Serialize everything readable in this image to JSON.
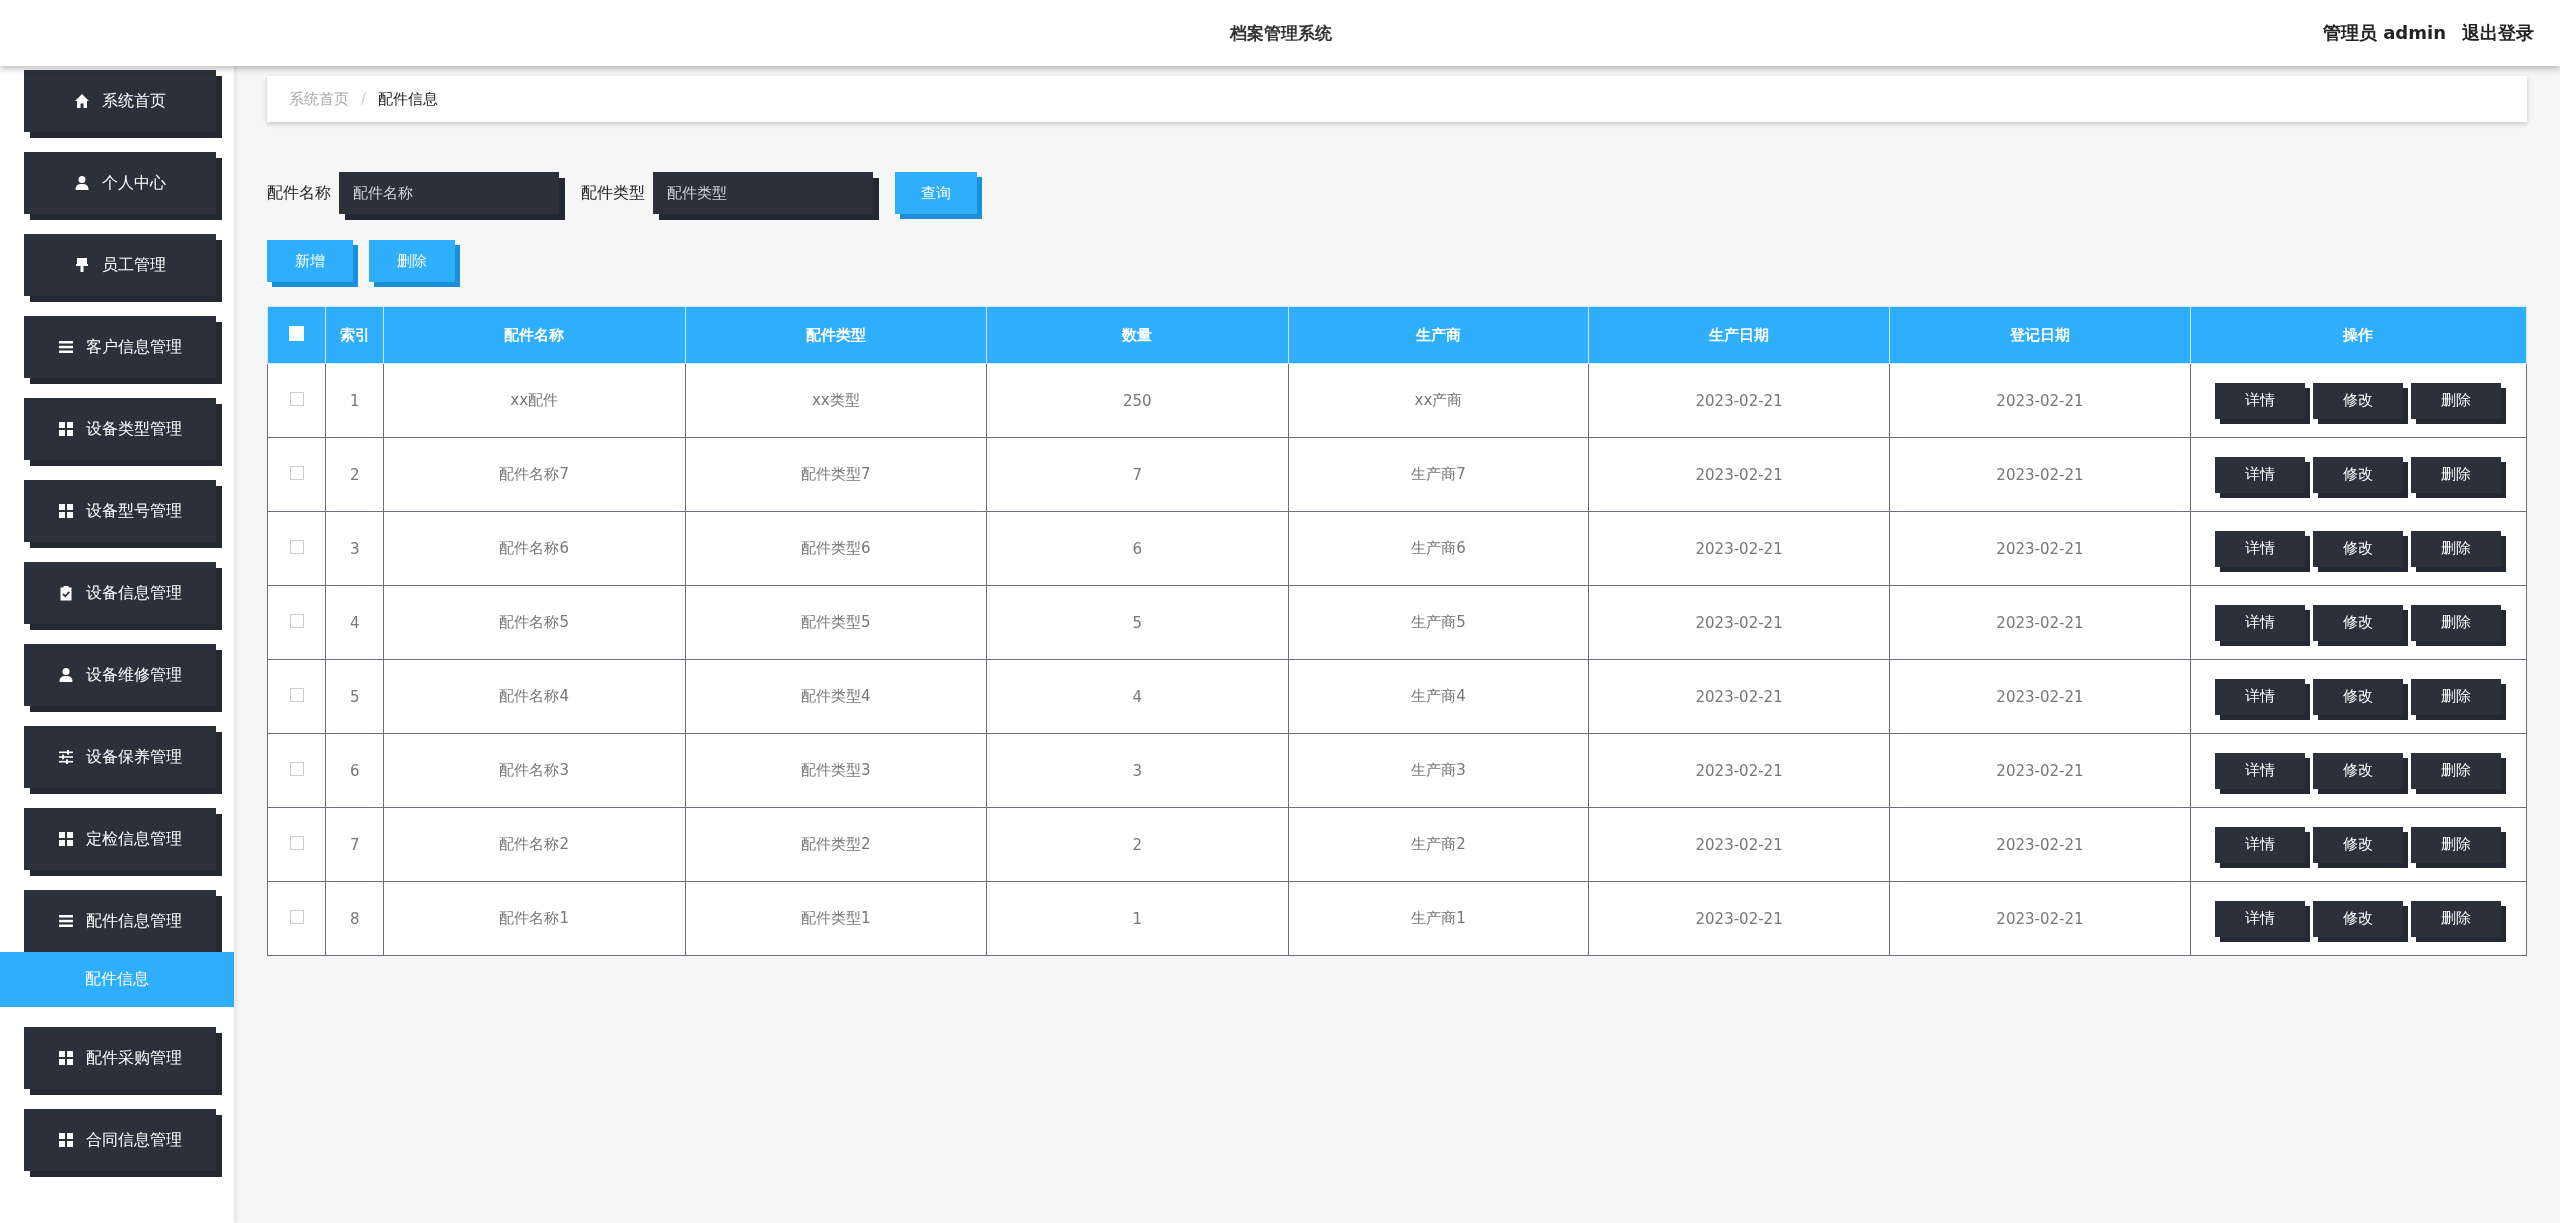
{
  "header": {
    "title": "档案管理系统",
    "user_label": "管理员 admin",
    "logout": "退出登录"
  },
  "sidebar": {
    "items": [
      {
        "label": "系统首页",
        "expanded": false
      },
      {
        "label": "个人中心",
        "expanded": false
      },
      {
        "label": "员工管理",
        "expanded": false
      },
      {
        "label": "客户信息管理",
        "expanded": false
      },
      {
        "label": "设备类型管理",
        "expanded": false
      },
      {
        "label": "设备型号管理",
        "expanded": false
      },
      {
        "label": "设备信息管理",
        "expanded": false
      },
      {
        "label": "设备维修管理",
        "expanded": false
      },
      {
        "label": "设备保养管理",
        "expanded": false
      },
      {
        "label": "定检信息管理",
        "expanded": false
      },
      {
        "label": "配件信息管理",
        "expanded": true,
        "children": [
          {
            "label": "配件信息",
            "selected": true
          }
        ]
      },
      {
        "label": "配件采购管理",
        "expanded": false
      },
      {
        "label": "合同信息管理",
        "expanded": false
      }
    ]
  },
  "breadcrumb": {
    "items": [
      "系统首页",
      "配件信息"
    ],
    "separator": "/"
  },
  "search": {
    "fields": [
      {
        "label": "配件名称",
        "placeholder": "配件名称"
      },
      {
        "label": "配件类型",
        "placeholder": "配件类型"
      }
    ],
    "button": "查询"
  },
  "actions": [
    "新增",
    "删除"
  ],
  "table": {
    "header_checked": false,
    "columns": [
      "索引",
      "配件名称",
      "配件类型",
      "数量",
      "生产商",
      "生产日期",
      "登记日期",
      "操作"
    ],
    "rows": [
      {
        "checked": false,
        "cells": [
          "1",
          "xx配件",
          "xx类型",
          "250",
          "xx产商",
          "2023-02-21",
          "2023-02-21"
        ],
        "buttons": [
          "详情",
          "修改",
          "删除"
        ]
      },
      {
        "checked": false,
        "cells": [
          "2",
          "配件名称7",
          "配件类型7",
          "7",
          "生产商7",
          "2023-02-21",
          "2023-02-21"
        ],
        "buttons": [
          "详情",
          "修改",
          "删除"
        ]
      },
      {
        "checked": false,
        "cells": [
          "3",
          "配件名称6",
          "配件类型6",
          "6",
          "生产商6",
          "2023-02-21",
          "2023-02-21"
        ],
        "buttons": [
          "详情",
          "修改",
          "删除"
        ]
      },
      {
        "checked": false,
        "cells": [
          "4",
          "配件名称5",
          "配件类型5",
          "5",
          "生产商5",
          "2023-02-21",
          "2023-02-21"
        ],
        "buttons": [
          "详情",
          "修改",
          "删除"
        ]
      },
      {
        "checked": false,
        "cells": [
          "5",
          "配件名称4",
          "配件类型4",
          "4",
          "生产商4",
          "2023-02-21",
          "2023-02-21"
        ],
        "buttons": [
          "详情",
          "修改",
          "删除"
        ]
      },
      {
        "checked": false,
        "cells": [
          "6",
          "配件名称3",
          "配件类型3",
          "3",
          "生产商3",
          "2023-02-21",
          "2023-02-21"
        ],
        "buttons": [
          "详情",
          "修改",
          "删除"
        ]
      },
      {
        "checked": false,
        "cells": [
          "7",
          "配件名称2",
          "配件类型2",
          "2",
          "生产商2",
          "2023-02-21",
          "2023-02-21"
        ],
        "buttons": [
          "详情",
          "修改",
          "删除"
        ]
      },
      {
        "checked": false,
        "cells": [
          "8",
          "配件名称1",
          "配件类型1",
          "1",
          "生产商1",
          "2023-02-21",
          "2023-02-21"
        ],
        "buttons": [
          "详情",
          "修改",
          "删除"
        ]
      }
    ]
  }
}
